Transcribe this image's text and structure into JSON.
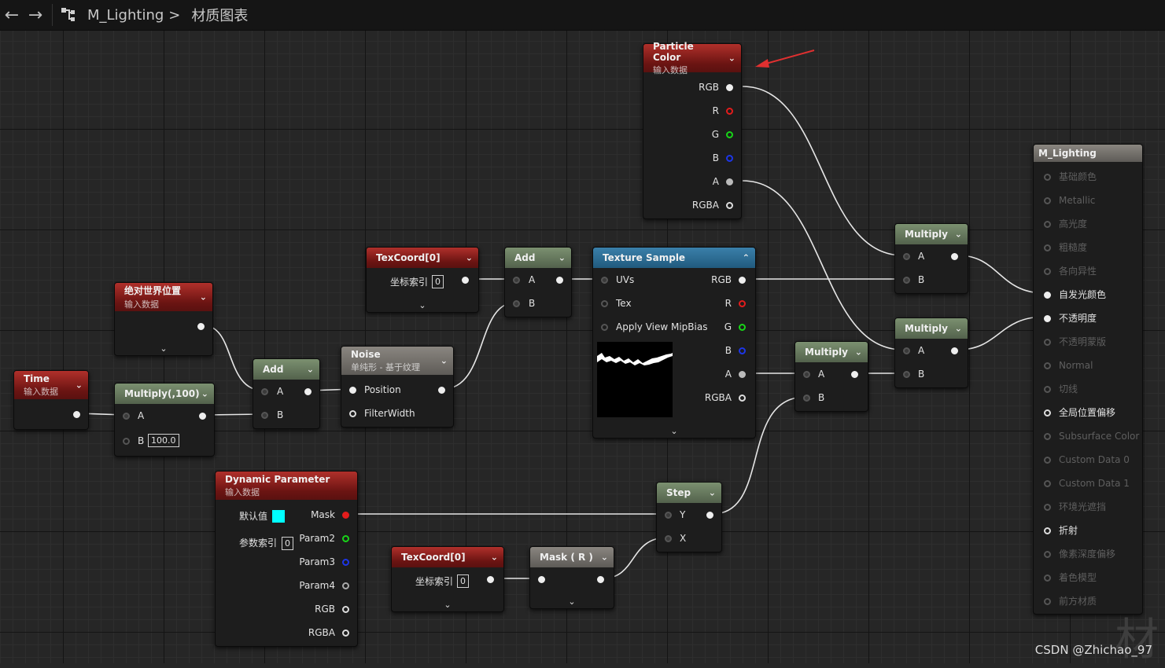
{
  "breadcrumb": {
    "asset": "M_Lighting",
    "separator": ">",
    "view": "材质图表"
  },
  "toolbar_icons": {
    "back": "back-arrow-icon",
    "forward": "forward-arrow-icon",
    "graph": "graph-hierarchy-icon"
  },
  "nodes": {
    "particle_color": {
      "title": "Particle Color",
      "subtitle": "输入数据",
      "outputs": [
        "RGB",
        "R",
        "G",
        "B",
        "A",
        "RGBA"
      ]
    },
    "texcoord_a": {
      "title": "TexCoord[0]",
      "index_label": "坐标索引",
      "index_value": "0"
    },
    "add_a": {
      "title": "Add",
      "in_a": "A",
      "in_b": "B"
    },
    "texture_sample": {
      "title": "Texture Sample",
      "inputs": [
        "UVs",
        "Tex",
        "Apply View MipBias"
      ],
      "outputs": [
        "RGB",
        "R",
        "G",
        "B",
        "A",
        "RGBA"
      ]
    },
    "abs_world_pos": {
      "title": "绝对世界位置",
      "subtitle": "输入数据"
    },
    "time": {
      "title": "Time",
      "subtitle": "输入数据"
    },
    "multiply_100": {
      "title": "Multiply(,100)",
      "in_a": "A",
      "in_b": "B",
      "b_value": "100.0"
    },
    "add_b": {
      "title": "Add",
      "in_a": "A",
      "in_b": "B"
    },
    "noise": {
      "title": "Noise",
      "subtitle": "单纯形 - 基于纹理",
      "inputs": [
        "Position",
        "FilterWidth"
      ]
    },
    "dynamic_param": {
      "title": "Dynamic Parameter",
      "subtitle": "输入数据",
      "default_label": "默认值",
      "index_label": "参数索引",
      "index_value": "0",
      "outputs": [
        "Mask",
        "Param2",
        "Param3",
        "Param4",
        "RGB",
        "RGBA"
      ]
    },
    "texcoord_b": {
      "title": "TexCoord[0]",
      "index_label": "坐标索引",
      "index_value": "0"
    },
    "mask_r": {
      "title": "Mask ( R )"
    },
    "step": {
      "title": "Step",
      "in_y": "Y",
      "in_x": "X"
    },
    "multiply_mid": {
      "title": "Multiply",
      "in_a": "A",
      "in_b": "B"
    },
    "multiply_top": {
      "title": "Multiply",
      "in_a": "A",
      "in_b": "B"
    },
    "multiply_bot": {
      "title": "Multiply",
      "in_a": "A",
      "in_b": "B"
    },
    "material_result": {
      "title": "M_Lighting",
      "pins": [
        {
          "label": "基础颜色",
          "active": false
        },
        {
          "label": "Metallic",
          "active": false
        },
        {
          "label": "高光度",
          "active": false
        },
        {
          "label": "粗糙度",
          "active": false
        },
        {
          "label": "各向异性",
          "active": false
        },
        {
          "label": "自发光颜色",
          "active": true
        },
        {
          "label": "不透明度",
          "active": true
        },
        {
          "label": "不透明蒙版",
          "active": false
        },
        {
          "label": "Normal",
          "active": false
        },
        {
          "label": "切线",
          "active": false
        },
        {
          "label": "全局位置偏移",
          "active": true
        },
        {
          "label": "Subsurface Color",
          "active": false
        },
        {
          "label": "Custom Data 0",
          "active": false
        },
        {
          "label": "Custom Data 1",
          "active": false
        },
        {
          "label": "环境光遮挡",
          "active": false
        },
        {
          "label": "折射",
          "active": true
        },
        {
          "label": "像素深度偏移",
          "active": false
        },
        {
          "label": "着色模型",
          "active": false
        },
        {
          "label": "前方材质",
          "active": false
        }
      ]
    }
  },
  "watermark": {
    "text": "CSDN @Zhichao_97",
    "corner_glyph": "材"
  },
  "colors": {
    "red_header": "#6b1412",
    "green_header": "#53624c",
    "blue_header": "#215a7e",
    "grey_header": "#5e5b57",
    "swatch": "#00ffff",
    "annotation_arrow": "#e03030"
  }
}
